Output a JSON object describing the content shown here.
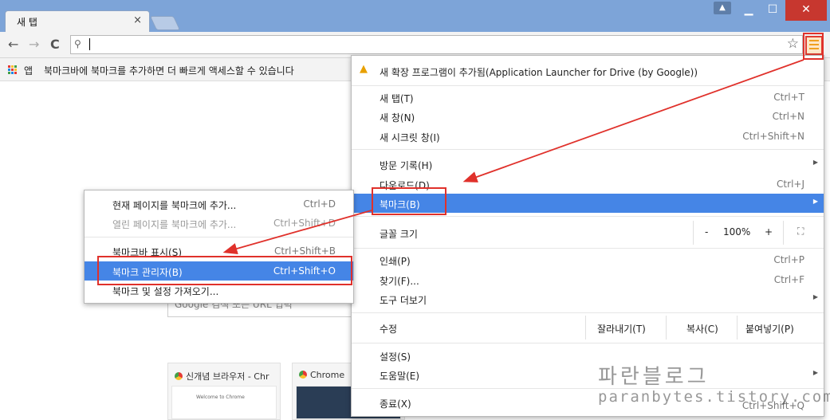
{
  "window": {
    "tab_title": "새 탭",
    "tab_close": "×",
    "minimize": "▁",
    "maximize": "☐",
    "close": "✕",
    "profile": "▲"
  },
  "toolbar": {
    "back": "←",
    "forward": "→",
    "reload": "C",
    "search_icon": "⚲",
    "url": "",
    "star": "☆"
  },
  "bookmark_bar": {
    "apps_label": "앱",
    "hint": "북마크바에 북마크를 추가하면 더 빠르게 액세스할 수 있습니다"
  },
  "ntp": {
    "search_placeholder": "Google 검색 또는 URL 입력",
    "thumbs": [
      {
        "title": "신개념 브라우저 - Chr",
        "shot_text": "Welcome to Chrome"
      },
      {
        "title": "Chrome "
      }
    ]
  },
  "main_menu": {
    "notice": "새 확장 프로그램이 추가됨(Application Launcher for Drive (by Google))",
    "items": [
      {
        "label": "새 탭(T)",
        "shortcut": "Ctrl+T"
      },
      {
        "label": "새 창(N)",
        "shortcut": "Ctrl+N"
      },
      {
        "label": "새 시크릿 창(I)",
        "shortcut": "Ctrl+Shift+N"
      },
      {
        "label": "방문 기록(H)",
        "shortcut": ""
      },
      {
        "label": "다운로드(D)",
        "shortcut": "Ctrl+J"
      },
      {
        "label": "북마크(B)",
        "shortcut": ""
      },
      {
        "label": "글꼴 크기",
        "shortcut": ""
      },
      {
        "label": "인쇄(P)",
        "shortcut": "Ctrl+P"
      },
      {
        "label": "찾기(F)...",
        "shortcut": "Ctrl+F"
      },
      {
        "label": "도구 더보기",
        "shortcut": ""
      },
      {
        "label": "수정",
        "shortcut": ""
      },
      {
        "label": "설정(S)",
        "shortcut": ""
      },
      {
        "label": "도움말(E)",
        "shortcut": ""
      },
      {
        "label": "종료(X)",
        "shortcut": "Ctrl+Shift+Q"
      }
    ],
    "zoom": {
      "minus": "-",
      "value": "100%",
      "plus": "+",
      "fullscreen": "⛶"
    },
    "edit": {
      "cut": "잘라내기(T)",
      "copy": "복사(C)",
      "paste": "붙여넣기(P)"
    }
  },
  "bookmark_submenu": {
    "items": [
      {
        "label": "현재 페이지를 북마크에 추가...",
        "shortcut": "Ctrl+D"
      },
      {
        "label": "열린 페이지를 북마크에 추가...",
        "shortcut": "Ctrl+Shift+D"
      },
      {
        "label": "북마크바 표시(S)",
        "shortcut": "Ctrl+Shift+B"
      },
      {
        "label": "북마크 관리자(B)",
        "shortcut": "Ctrl+Shift+O"
      },
      {
        "label": "북마크 및 설정 가져오기...",
        "shortcut": ""
      }
    ]
  },
  "watermark": {
    "title": "파란블로그",
    "url": "paranbytes.tistory.com"
  },
  "colors": {
    "highlight": "#4585e6",
    "annotation_red": "#e0312b",
    "titlebar": "#7da4d8"
  }
}
